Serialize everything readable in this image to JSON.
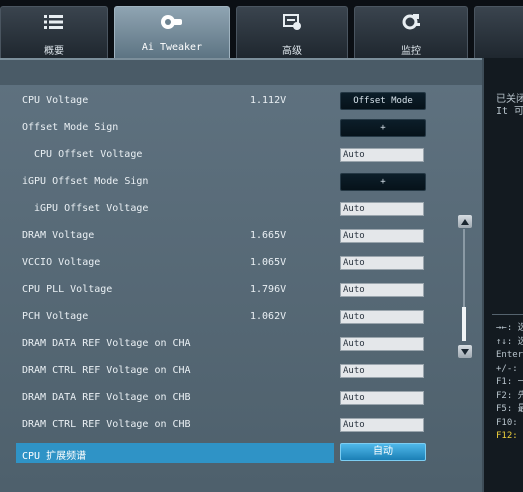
{
  "tabs": [
    {
      "label": "概要",
      "icon": "list-icon",
      "active": false
    },
    {
      "label": "Ai Tweaker",
      "icon": "ai-tweaker-icon",
      "active": true
    },
    {
      "label": "高级",
      "icon": "advanced-icon",
      "active": false
    },
    {
      "label": "监控",
      "icon": "monitor-icon",
      "active": false
    }
  ],
  "settings": [
    {
      "label": "CPU Voltage",
      "current": "1.112V",
      "control": "Offset Mode"
    },
    {
      "label": "Offset Mode Sign",
      "current": "",
      "control": "+"
    },
    {
      "label": "CPU Offset Voltage",
      "current": "",
      "control": "Auto"
    },
    {
      "label": "iGPU Offset Mode Sign",
      "current": "",
      "control": "+"
    },
    {
      "label": "iGPU Offset Voltage",
      "current": "",
      "control": "Auto"
    },
    {
      "label": "DRAM Voltage",
      "current": "1.665V",
      "control": "Auto"
    },
    {
      "label": "VCCIO Voltage",
      "current": "1.065V",
      "control": "Auto"
    },
    {
      "label": "CPU PLL Voltage",
      "current": "1.796V",
      "control": "Auto"
    },
    {
      "label": "PCH Voltage",
      "current": "1.062V",
      "control": "Auto"
    },
    {
      "label": "DRAM DATA REF Voltage on CHA",
      "current": "",
      "control": "Auto"
    },
    {
      "label": "DRAM CTRL REF Voltage on CHA",
      "current": "",
      "control": "Auto"
    },
    {
      "label": "DRAM DATA REF Voltage on CHB",
      "current": "",
      "control": "Auto"
    },
    {
      "label": "DRAM CTRL REF Voltage on CHB",
      "current": "",
      "control": "Auto"
    },
    {
      "label": "CPU 扩展频谱",
      "current": "",
      "control": "自动"
    }
  ],
  "help": {
    "desc_line1": "已关闭",
    "desc_line2": "It 可",
    "keys": [
      {
        "text": "→←: 选"
      },
      {
        "text": "↑↓: 选"
      },
      {
        "text": "Enter"
      },
      {
        "text": "+/-: "
      },
      {
        "text": "F1: 一"
      },
      {
        "text": "F2: 先"
      },
      {
        "text": "F5: 最"
      },
      {
        "text": "F10: "
      },
      {
        "text": "F12: "
      }
    ]
  }
}
